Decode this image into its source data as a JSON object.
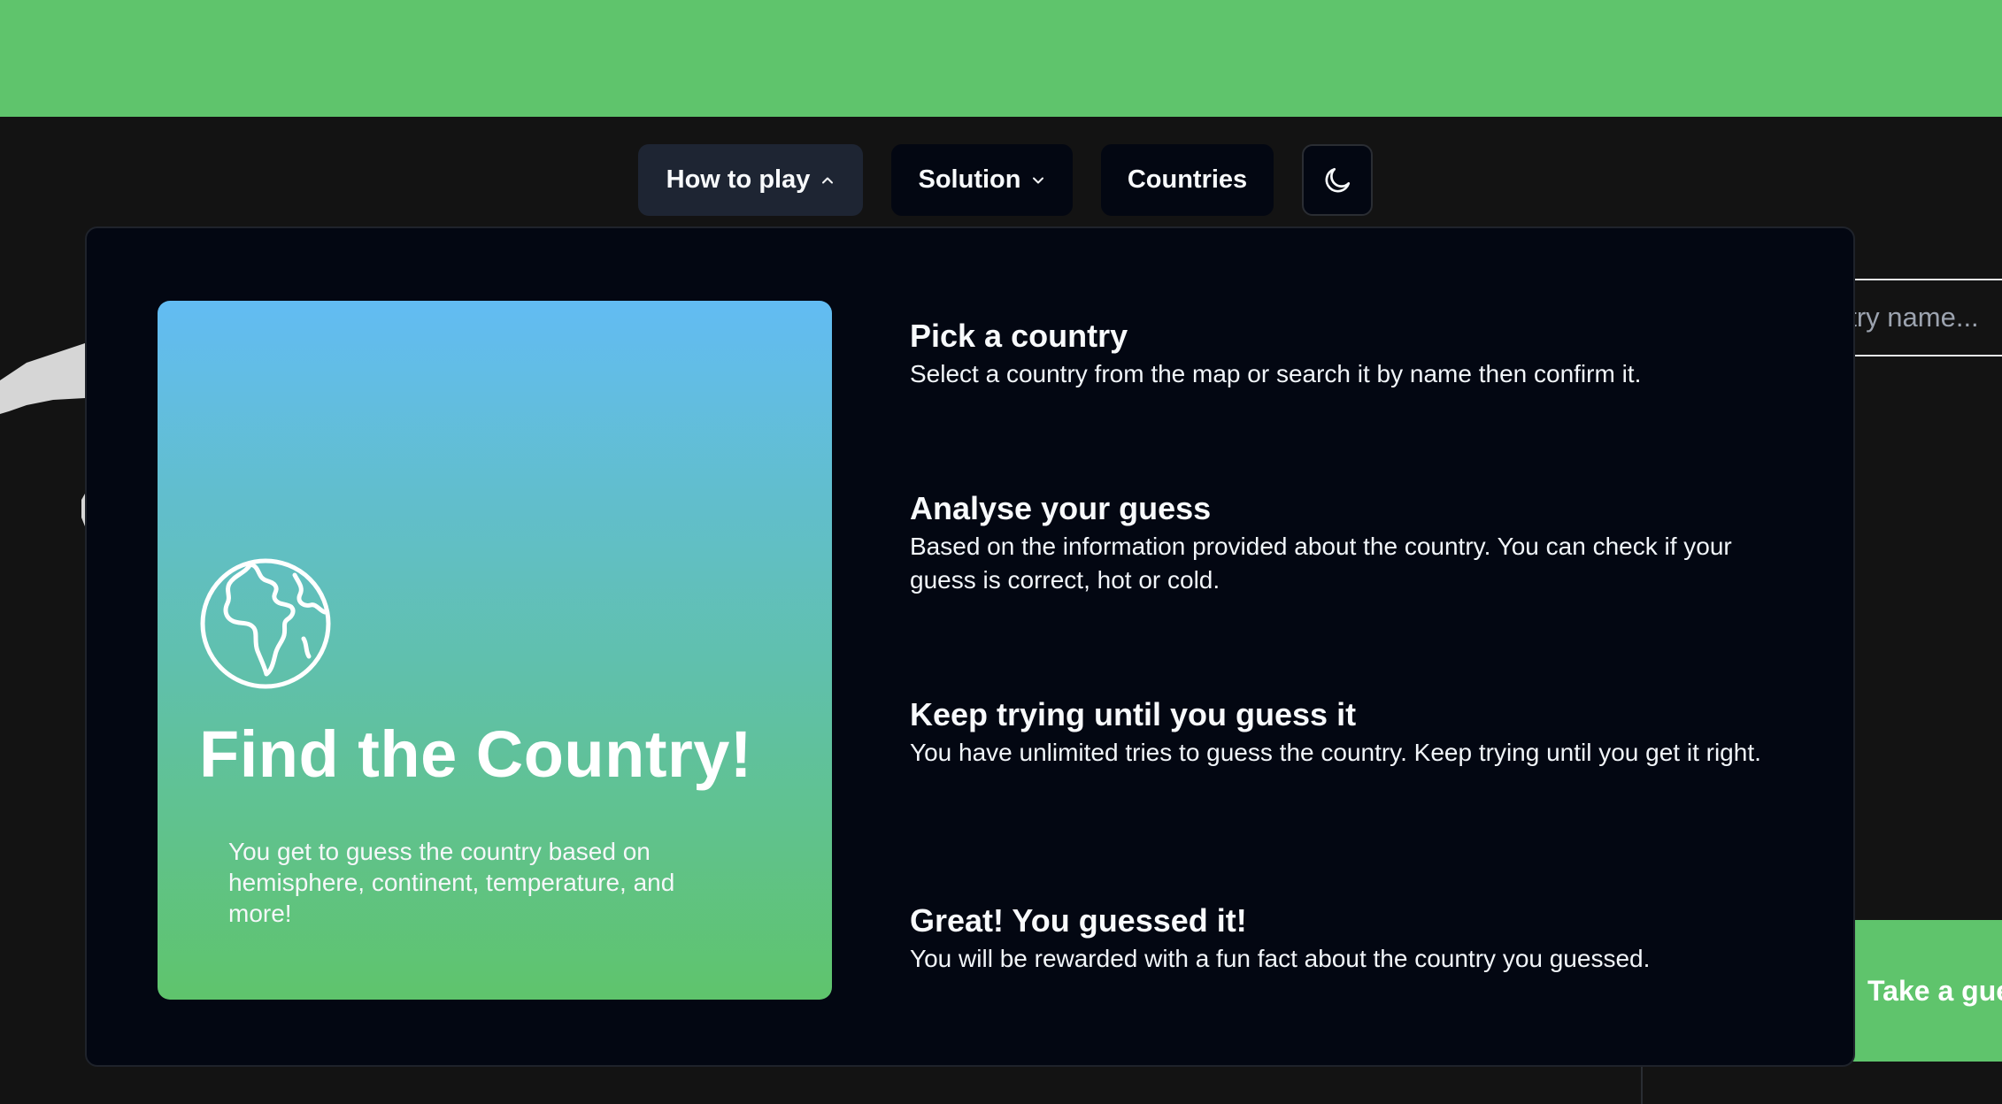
{
  "nav": {
    "how_to_play": "How to play",
    "solution": "Solution",
    "countries": "Countries",
    "theme_icon": "moon-icon"
  },
  "background": {
    "search_placeholder": "Search country name...",
    "search_visible": "ntry name...",
    "take_guess_label": "Take a guess",
    "take_guess_visible": "Take a gue"
  },
  "hero": {
    "icon": "globe-africa-icon",
    "title": "Find the Country!",
    "description": "You get to guess the country based on hemisphere, continent, temperature, and more!"
  },
  "steps": [
    {
      "title": "Pick a country",
      "text": "Select a country from the map or search it by name then confirm it."
    },
    {
      "title": "Analyse your guess",
      "text": "Based on the information provided about the country. You can check if your guess is correct, hot or cold."
    },
    {
      "title": "Keep trying until you guess it",
      "text": "You have unlimited tries to guess the country. Keep trying until you get it right."
    },
    {
      "title": "Great! You guessed it!",
      "text": "You will be rewarded with a fun fact about the country you guessed."
    }
  ],
  "colors": {
    "accent_green": "#5fc46c",
    "gradient_top": "#62bcf3",
    "popover_bg": "#030712",
    "page_bg": "#131313"
  }
}
